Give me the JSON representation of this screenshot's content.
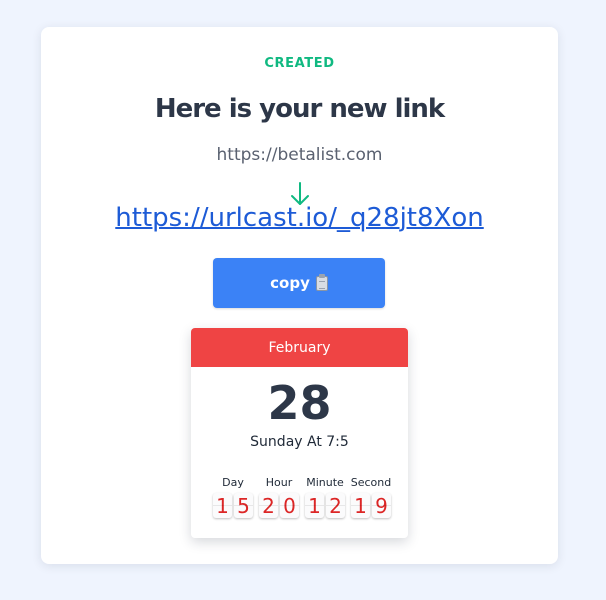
{
  "status": "CREATED",
  "heading": "Here is your new link",
  "original_url": "https://betalist.com",
  "arrow_icon": "arrow-down-icon",
  "short_url": "https://urlcast.io/_q28jt8Xon",
  "copy_button": {
    "label": "copy",
    "icon": "clipboard-icon"
  },
  "calendar": {
    "month": "February",
    "day": "28",
    "subtitle": "Sunday At 7:5",
    "countdown": [
      {
        "label": "Day",
        "digits": [
          "1",
          "5"
        ]
      },
      {
        "label": "Hour",
        "digits": [
          "2",
          "0"
        ]
      },
      {
        "label": "Minute",
        "digits": [
          "1",
          "2"
        ]
      },
      {
        "label": "Second",
        "digits": [
          "1",
          "9"
        ]
      }
    ]
  },
  "colors": {
    "page_background": "#eff4fe",
    "accent_green": "#10b981",
    "link_blue": "#1d5bd6",
    "button_blue": "#3b82f6",
    "calendar_red": "#ef4444",
    "digit_red": "#dc2626"
  }
}
